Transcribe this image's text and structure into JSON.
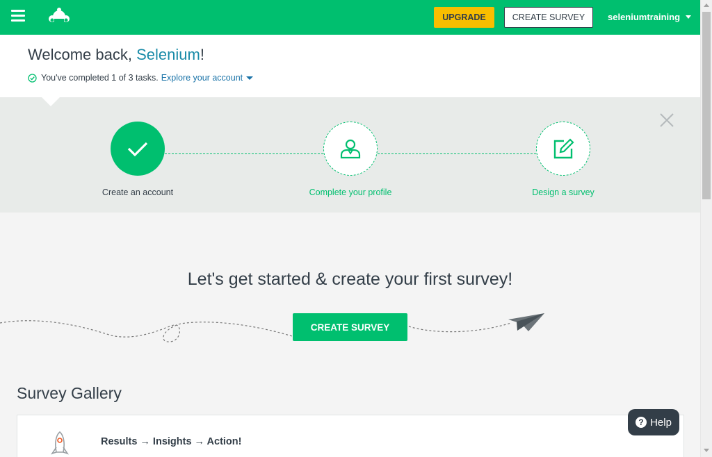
{
  "header": {
    "menu_icon": "hamburger-icon",
    "logo_icon": "surveymonkey-logo-icon",
    "upgrade_label": "UPGRADE",
    "create_survey_label": "CREATE SURVEY",
    "username": "seleniumtraining"
  },
  "welcome": {
    "greeting": "Welcome back, ",
    "name": "Selenium",
    "punct": "!",
    "tasks_text": "You've completed 1 of 3 tasks.",
    "explore_link": "Explore your account"
  },
  "steps": [
    {
      "label": "Create an account",
      "status": "done",
      "icon": "checkmark-icon"
    },
    {
      "label": "Complete your profile",
      "status": "todo",
      "icon": "user-profile-icon"
    },
    {
      "label": "Design a survey",
      "status": "todo",
      "icon": "edit-icon"
    }
  ],
  "hero": {
    "title": "Let's get started & create your first survey!",
    "button_label": "CREATE SURVEY"
  },
  "gallery": {
    "title": "Survey Gallery",
    "card_title": "Results → Insights → Action!"
  },
  "help_label": "Help",
  "colors": {
    "brand_green": "#00bf6f",
    "upgrade_yellow": "#f9be00",
    "dark_text": "#333e48",
    "link_blue": "#1a73a8"
  }
}
